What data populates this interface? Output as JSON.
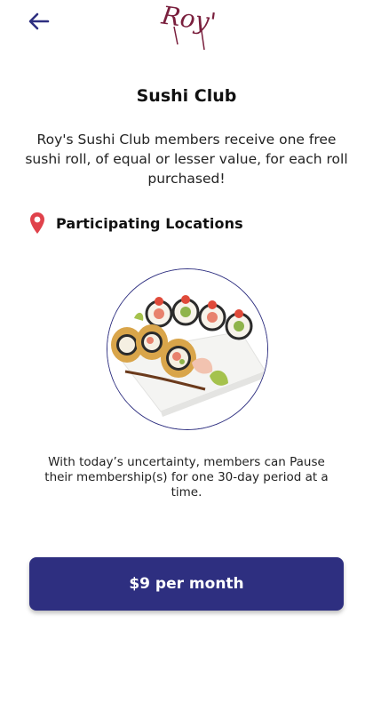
{
  "header": {
    "back_icon": "arrow-left-icon",
    "logo_text": "Roy's"
  },
  "main": {
    "title": "Sushi Club",
    "description": "Roy's Sushi Club members receive one free sushi roll, of equal or lesser value, for each roll purchased!",
    "locations": {
      "icon": "map-pin-icon",
      "label": "Participating Locations"
    },
    "note": "With today’s uncertainty, members can Pause their membership(s) for one 30-day period at a time.",
    "cta_label": "$9 per month"
  },
  "colors": {
    "primary": "#2e2f80",
    "logo": "#7a1f3d",
    "pin": "#e0424b"
  }
}
